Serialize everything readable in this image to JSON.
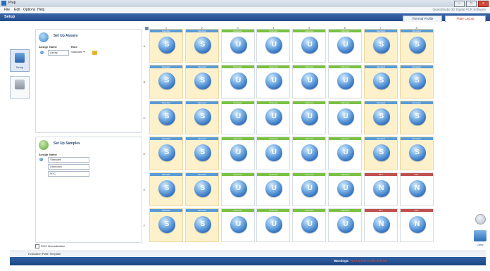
{
  "window": {
    "title": "Prep"
  },
  "menu": {
    "items": [
      "File",
      "Edit",
      "Options",
      "Help"
    ],
    "info": "QuantStudio 3D Digital PCR Software"
  },
  "setup_bar": {
    "label": "Setup",
    "tabs": [
      "Thermal Profile",
      "Plate Layout"
    ],
    "active_tab": 1
  },
  "left_nav": [
    {
      "label": "Setup",
      "icon": "grid-setup-icon"
    },
    {
      "label": "",
      "icon": "device-icon"
    }
  ],
  "assays_panel": {
    "title": "Set Up Assays",
    "headers": [
      "Assign",
      "Name",
      "Role"
    ],
    "row": {
      "name": "Assay",
      "role": "Standard"
    }
  },
  "samples_panel": {
    "title": "Set Up Samples",
    "headers": [
      "Assign",
      "Name"
    ],
    "rows": [
      "Standard",
      "Unknown",
      "NTC"
    ]
  },
  "normalization_label": "ROX Normalization",
  "plate": {
    "columns": [
      "1",
      "2",
      "3",
      "4",
      "5",
      "6",
      "7",
      "8"
    ],
    "rows": [
      "A",
      "B",
      "C",
      "D",
      "E",
      "F"
    ],
    "wells": [
      [
        "S",
        "S",
        "U",
        "U",
        "U",
        "U",
        "S",
        "S"
      ],
      [
        "S",
        "S",
        "U",
        "U",
        "U",
        "U",
        "S",
        "S"
      ],
      [
        "S",
        "S",
        "U",
        "U",
        "U",
        "U",
        "S",
        "S"
      ],
      [
        "S",
        "S",
        "U",
        "U",
        "U",
        "U",
        "S",
        "S"
      ],
      [
        "S",
        "S",
        "U",
        "U",
        "U",
        "U",
        "N",
        "N"
      ],
      [
        "S",
        "S",
        "U",
        "U",
        "U",
        "U",
        "N",
        "N"
      ]
    ],
    "bar_labels": {
      "S": "Standard",
      "U": "Unknown",
      "N": "NTC"
    }
  },
  "right_controls": {
    "clear_label": "Clear"
  },
  "bottom_tabs": [
    "Evaluation Plate Template"
  ],
  "status": {
    "label": "Warnings:",
    "message": "No thermal profile defined"
  },
  "colors": {
    "std_bar": "#5a9bd5",
    "unk_bar": "#7ac143",
    "ntc_bar": "#c0504d",
    "std_well": "#fdf1cc"
  }
}
